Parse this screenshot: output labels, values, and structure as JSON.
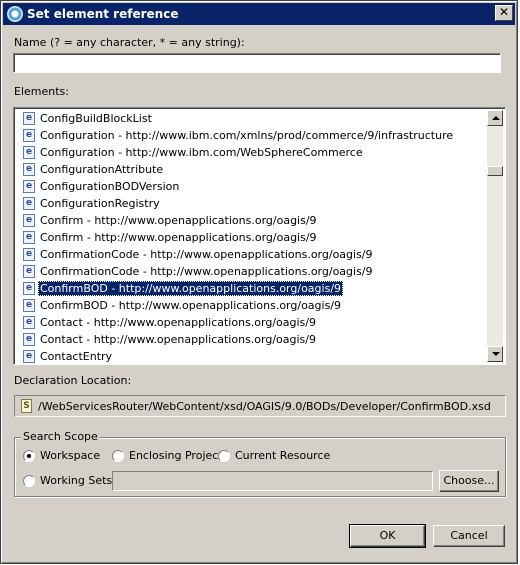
{
  "window": {
    "title": "Set element reference",
    "close_glyph": "✕"
  },
  "name": {
    "label": "Name (? = any character, * = any string):",
    "value": "",
    "placeholder": ""
  },
  "elements": {
    "label": "Elements:",
    "icon_letter": "e",
    "items": [
      "ConfigBuildBlockList",
      "Configuration - http://www.ibm.com/xmlns/prod/commerce/9/infrastructure",
      "Configuration - http://www.ibm.com/WebSphereCommerce",
      "ConfigurationAttribute",
      "ConfigurationBODVersion",
      "ConfigurationRegistry",
      "Confirm - http://www.openapplications.org/oagis/9",
      "Confirm - http://www.openapplications.org/oagis/9",
      "ConfirmationCode - http://www.openapplications.org/oagis/9",
      "ConfirmationCode - http://www.openapplications.org/oagis/9",
      "ConfirmBOD - http://www.openapplications.org/oagis/9",
      "ConfirmBOD - http://www.openapplications.org/oagis/9",
      "Contact - http://www.openapplications.org/oagis/9",
      "Contact - http://www.openapplications.org/oagis/9",
      "ContactEntry"
    ],
    "selected_index": 10
  },
  "declaration": {
    "label": "Declaration Location:",
    "icon_letter": "S",
    "path": "/WebServicesRouter/WebContent/xsd/OAGIS/9.0/BODs/Developer/ConfirmBOD.xsd"
  },
  "search_scope": {
    "title": "Search Scope",
    "options": [
      "Workspace",
      "Enclosing Project",
      "Current Resource",
      "Working Sets"
    ],
    "selected": "Workspace",
    "working_sets_value": "",
    "choose_label": "Choose..."
  },
  "buttons": {
    "ok": "OK",
    "cancel": "Cancel"
  },
  "colors": {
    "title_bar": "#0a246a",
    "dialog_bg": "#d4d0c8",
    "selection": "#0a246a"
  }
}
